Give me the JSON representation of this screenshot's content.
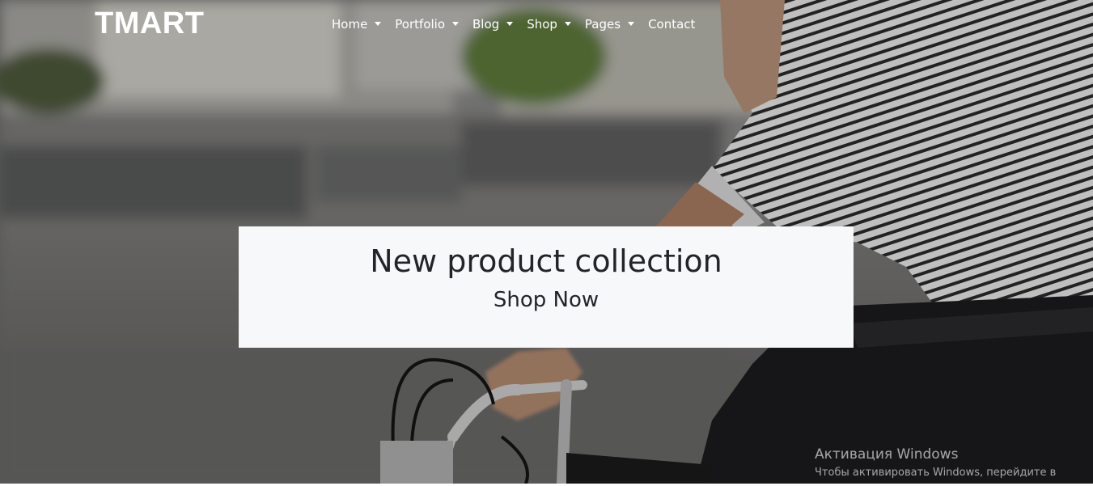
{
  "brand": "TMART",
  "nav": [
    {
      "label": "Home",
      "dropdown": true
    },
    {
      "label": "Portfolio",
      "dropdown": true
    },
    {
      "label": "Blog",
      "dropdown": true
    },
    {
      "label": "Shop",
      "dropdown": true
    },
    {
      "label": "Pages",
      "dropdown": true
    },
    {
      "label": "Contact",
      "dropdown": false
    }
  ],
  "hero": {
    "title": "New product collection",
    "cta_label": "Shop Now",
    "image": "cyclist-riding-bicycle-photo"
  },
  "watermark": {
    "title": "Активация Windows",
    "subtitle": "Чтобы активировать Windows, перейдите в"
  },
  "colors": {
    "cta_bg": "#f7f8fa",
    "text_dark": "#212529",
    "nav_text": "#ffffff"
  }
}
